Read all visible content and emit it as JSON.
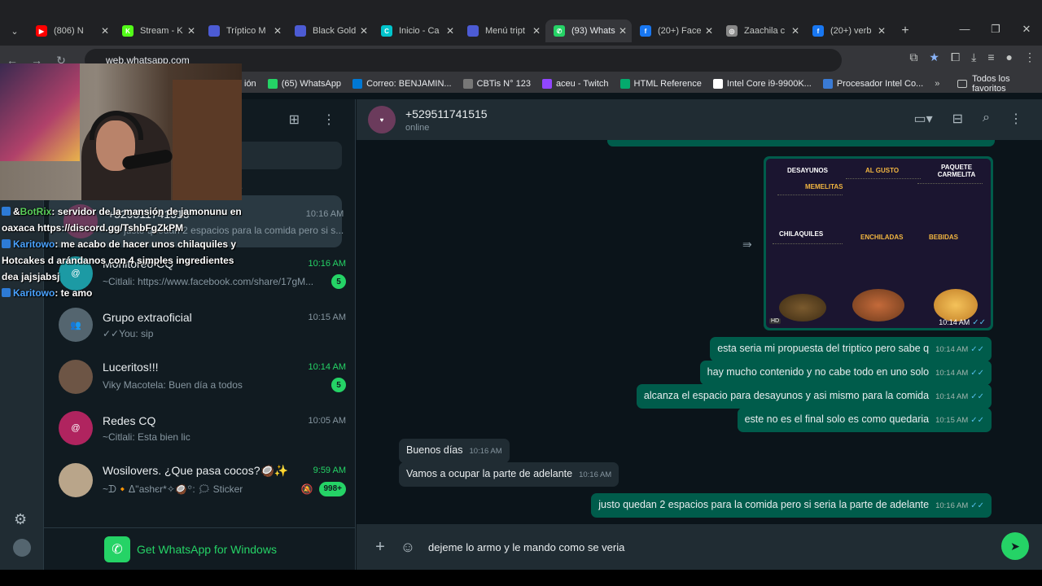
{
  "browser": {
    "tabs": [
      {
        "title": "(806) N",
        "color": "#ff0000",
        "glyph": "▶"
      },
      {
        "title": "Stream - K",
        "color": "#53fc18",
        "glyph": "K"
      },
      {
        "title": "Tríptico M",
        "color": "#4c5bd4",
        "glyph": ""
      },
      {
        "title": "Black Gold",
        "color": "#4c5bd4",
        "glyph": ""
      },
      {
        "title": "Inicio - Ca",
        "color": "#00c4cc",
        "glyph": "C"
      },
      {
        "title": "Menú tript",
        "color": "#4c5bd4",
        "glyph": ""
      },
      {
        "title": "(93) Whats",
        "color": "#25d366",
        "glyph": "✆"
      },
      {
        "title": "(20+) Face",
        "color": "#1877f2",
        "glyph": "f"
      },
      {
        "title": "Zaachila c",
        "color": "#888888",
        "glyph": "◎"
      },
      {
        "title": "(20+) verb",
        "color": "#1877f2",
        "glyph": "f"
      }
    ],
    "url": "web.whatsapp.com",
    "bookmarks": [
      {
        "label": "ión",
        "color": "#555555"
      },
      {
        "label": "(65) WhatsApp",
        "color": "#25d366"
      },
      {
        "label": "Correo: BENJAMIN...",
        "color": "#0078d4"
      },
      {
        "label": "CBTis N° 123",
        "color": "#777777"
      },
      {
        "label": "aceu - Twitch",
        "color": "#9146ff"
      },
      {
        "label": "HTML Reference",
        "color": "#04aa6d"
      },
      {
        "label": "Intel Core i9-9900K...",
        "color": "#ffffff"
      },
      {
        "label": "Procesador Intel Co...",
        "color": "#3a7bd5"
      }
    ],
    "bookmarks_more": "»",
    "all_favorites": "Todos los favoritos"
  },
  "stream_chat": [
    {
      "user": "BotRix",
      "prefix": "&",
      "text": ": servidor de la mansión de jamonunu en oaxaca https://discord.gg/TshbFgZkPM"
    },
    {
      "user": "Karitowo",
      "prefix": "",
      "text": ": me acabo de hacer unos chilaquiles y Hotcakes d arándanos con 4 simples ingredientes dea jajsjabsj"
    },
    {
      "user": "Karitowo",
      "prefix": "",
      "text": ": te amo"
    }
  ],
  "sidebar": {
    "partial_label": "os",
    "chats": [
      {
        "name": "+529511741515",
        "time": "10:16 AM",
        "time_green": false,
        "msg": "✓✓justo quedan 2 espacios para la comida pero si s...",
        "badge": "",
        "avatar": "",
        "avatar_color": "#6b3b5c"
      },
      {
        "name": "Monitoreo CQ",
        "time": "10:16 AM",
        "time_green": true,
        "msg": "~Citlali: https://www.facebook.com/share/17gM...",
        "badge": "5",
        "avatar": "@",
        "avatar_color": "#1c9aa4"
      },
      {
        "name": "Grupo extraoficial",
        "time": "10:15 AM",
        "time_green": false,
        "msg": "✓✓You: sip",
        "badge": "",
        "avatar": "👥",
        "avatar_color": "#54656f"
      },
      {
        "name": "Luceritos!!!",
        "time": "10:14 AM",
        "time_green": true,
        "msg": "Viky Macotela: Buen día a todos",
        "badge": "5",
        "avatar": "",
        "avatar_color": "#6d5545"
      },
      {
        "name": "Redes CQ",
        "time": "10:05 AM",
        "time_green": false,
        "msg": "~Citlali: Esta bien lic",
        "badge": "",
        "avatar": "@",
        "avatar_color": "#b0245f"
      },
      {
        "name": "Wosilovers. ¿Que pasa cocos?🥥✨",
        "time": "9:59 AM",
        "time_green": true,
        "msg": "~ᗪ🔸ᐃ''ashєr*✧🥥꙳: 🗯 Sticker",
        "badge": "998+",
        "avatar": "",
        "avatar_color": "#b9a58a"
      }
    ],
    "get_app": "Get WhatsApp for Windows"
  },
  "conversation": {
    "contact_name": "+529511741515",
    "status": "online",
    "image_msg": {
      "time": "10:14 AM",
      "hd": "HD",
      "sections": {
        "desayunos": "DESAYUNOS",
        "memelitas": "MEMELITAS",
        "al_gusto": "AL GUSTO",
        "paquete": "PAQUETE CARMELITA",
        "chilaquiles": "CHILAQUILES",
        "enchiladas": "ENCHILADAS",
        "bebidas": "BEBIDAS"
      }
    },
    "messages": [
      {
        "dir": "out",
        "text": "esta seria mi propuesta del triptico pero sabe q",
        "time": "10:14 AM"
      },
      {
        "dir": "out",
        "text": "hay mucho contenido y no cabe todo en uno solo",
        "time": "10:14 AM"
      },
      {
        "dir": "out",
        "text": "alcanza el espacio para desayunos y asi mismo para la comida",
        "time": "10:14 AM"
      },
      {
        "dir": "out",
        "text": "este no es el final solo es como quedaria",
        "time": "10:15 AM"
      },
      {
        "dir": "in",
        "text": "Buenos días",
        "time": "10:16 AM"
      },
      {
        "dir": "in",
        "text": "Vamos a ocupar la parte de adelante",
        "time": "10:16 AM"
      },
      {
        "dir": "out",
        "text": "justo quedan 2 espacios para la comida pero si seria la parte de adelante",
        "time": "10:16 AM"
      }
    ],
    "composer_text": "dejeme lo armo y le mando como se veria"
  },
  "colors": {
    "accent": "#25d366",
    "outgoing": "#005c4b",
    "incoming": "#202c33",
    "background": "#0b141a"
  }
}
